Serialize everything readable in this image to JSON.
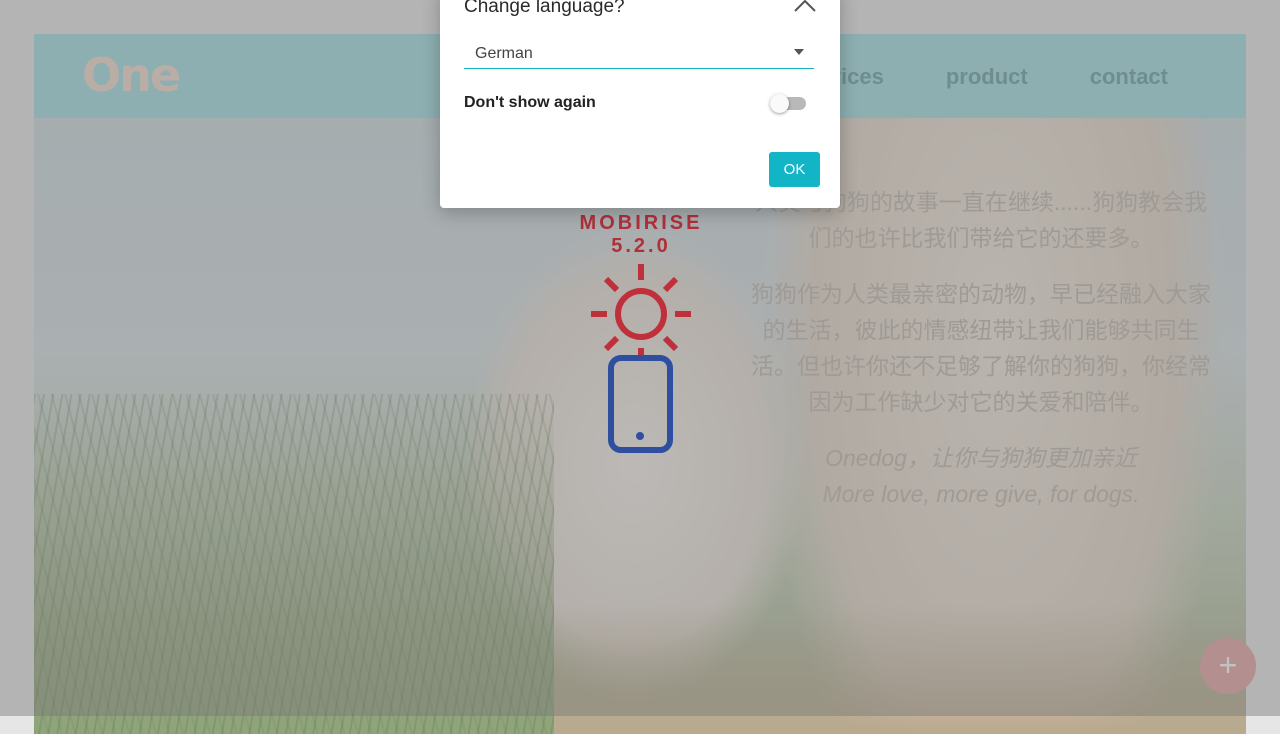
{
  "site": {
    "logo_text": "One",
    "nav": [
      "services",
      "product",
      "contact"
    ],
    "hero_lines": [
      "人类与狗狗的故事一直在继续......狗狗教会我们的也许比我们带给它的还要多。",
      "狗狗作为人类最亲密的动物，早已经融入大家的生活，彼此的情感纽带让我们能够共同生活。但也许你还不足够了解你的狗狗，你经常因为工作缺少对它的关爱和陪伴。"
    ],
    "tagline_1": "Onedog，让你与狗狗更加亲近",
    "tagline_2": "More love, more give, for dogs.",
    "fab_icon": "plus-icon"
  },
  "badge": {
    "title": "MOBIRISE  5.2.0",
    "icon": "mobirise-sun-phone-icon",
    "colors": {
      "sun": "#c0303a",
      "phone": "#2f4ea0"
    }
  },
  "dialog": {
    "title": "Change language?",
    "close_icon": "chevron-up-icon",
    "language_value": "German",
    "dont_show_label": "Don't show again",
    "dont_show_checked": false,
    "ok_label": "OK",
    "accent": "#12b5c6"
  }
}
